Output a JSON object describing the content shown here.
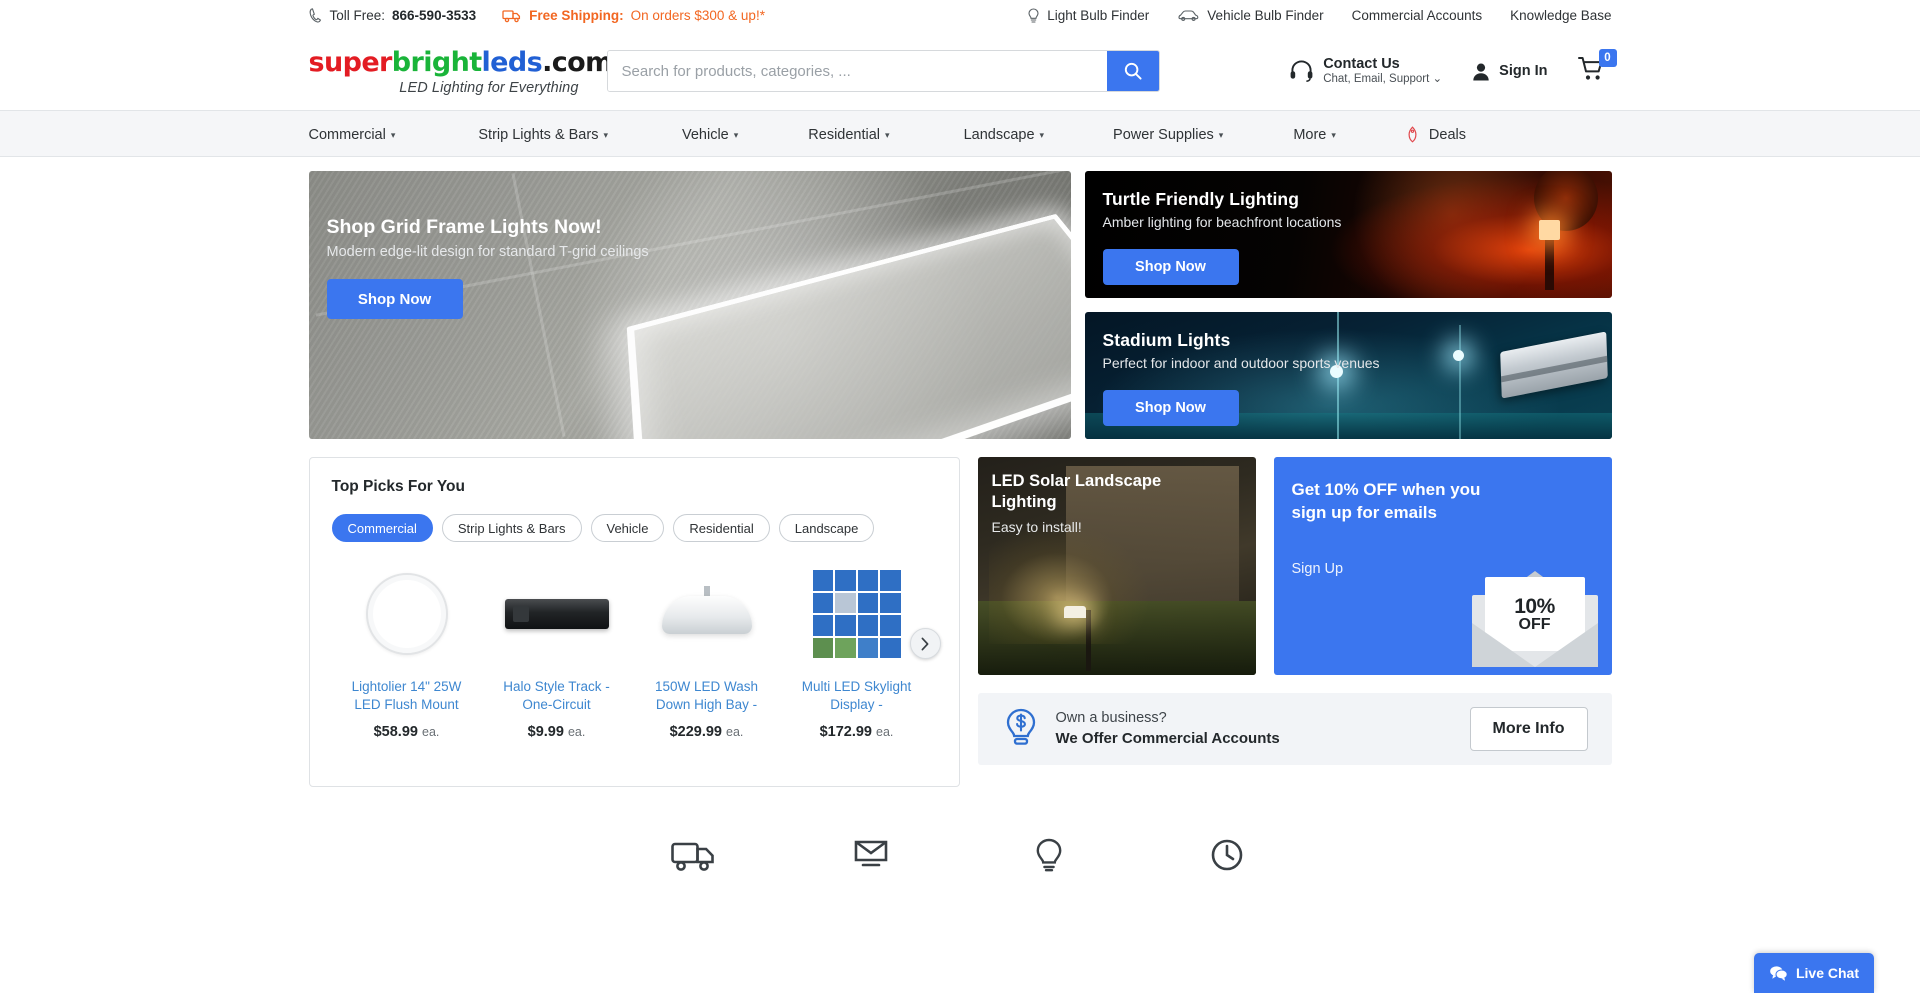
{
  "topbar": {
    "toll_free_label": "Toll Free:",
    "toll_free_number": "866-590-3533",
    "free_shipping_label": "Free Shipping:",
    "free_shipping_detail": "On orders $300 & up!*",
    "links": [
      {
        "label": "Light Bulb Finder",
        "icon": "lightbulb-icon"
      },
      {
        "label": "Vehicle Bulb Finder",
        "icon": "car-icon"
      },
      {
        "label": "Commercial Accounts",
        "icon": ""
      },
      {
        "label": "Knowledge Base",
        "icon": ""
      }
    ]
  },
  "header": {
    "logo": {
      "part1": "super",
      "part2": "bright",
      "part3": "leds",
      "part4": ".com",
      "reg": "®"
    },
    "tagline": "LED Lighting for Everything",
    "search": {
      "placeholder": "Search for products, categories, ...",
      "value": "",
      "button_icon": "search-icon"
    },
    "contact": {
      "title": "Contact Us",
      "subtitle": "Chat, Email, Support",
      "caret": "⌄"
    },
    "signin_label": "Sign In",
    "cart_count": "0"
  },
  "nav": {
    "items": [
      {
        "label": "Commercial",
        "caret": "▾"
      },
      {
        "label": "Strip Lights & Bars",
        "caret": "▾"
      },
      {
        "label": "Vehicle",
        "caret": "▾"
      },
      {
        "label": "Residential",
        "caret": "▾"
      },
      {
        "label": "Landscape",
        "caret": "▾"
      },
      {
        "label": "Power Supplies",
        "caret": "▾"
      },
      {
        "label": "More",
        "caret": "▾"
      }
    ],
    "deals_label": "Deals"
  },
  "hero": {
    "title": "Shop Grid Frame Lights Now!",
    "subtitle": "Modern edge-lit design for standard T-grid ceilings",
    "cta": "Shop Now"
  },
  "tiles": [
    {
      "title": "Turtle Friendly Lighting",
      "subtitle": "Amber lighting for beachfront locations",
      "cta": "Shop Now"
    },
    {
      "title": "Stadium Lights",
      "subtitle": "Perfect for indoor and outdoor sports venues",
      "cta": "Shop Now"
    }
  ],
  "top_picks": {
    "title": "Top Picks For You",
    "tabs": [
      {
        "label": "Commercial",
        "active": true
      },
      {
        "label": "Strip Lights & Bars",
        "active": false
      },
      {
        "label": "Vehicle",
        "active": false
      },
      {
        "label": "Residential",
        "active": false
      },
      {
        "label": "Landscape",
        "active": false
      }
    ],
    "products": [
      {
        "name": "Lightolier 14\" 25W LED Flush Mount",
        "price": "$58.99",
        "unit": "ea."
      },
      {
        "name": "Halo Style Track - One-Circuit",
        "price": "$9.99",
        "unit": "ea."
      },
      {
        "name": "150W LED Wash Down High Bay -",
        "price": "$229.99",
        "unit": "ea."
      },
      {
        "name": "Multi LED Skylight Display -",
        "price": "$172.99",
        "unit": "ea."
      }
    ],
    "next_icon": "chevron-right-icon"
  },
  "solar_card": {
    "title": "LED Solar Landscape Lighting",
    "subtitle": "Easy to install!"
  },
  "email_card": {
    "title": "Get 10% OFF when you sign up for emails",
    "link": "Sign Up",
    "badge_line1": "10%",
    "badge_line2": "OFF"
  },
  "business_bar": {
    "line1": "Own a business?",
    "line2": "We Offer Commercial Accounts",
    "button": "More Info",
    "icon": "lightbulb-dollar-icon"
  },
  "live_chat": {
    "label": "Live Chat",
    "icon": "chat-bubbles-icon"
  },
  "colors": {
    "accent_blue": "#3b76ef",
    "orange": "#f26722",
    "logo_red": "#e31c23",
    "logo_green": "#19b439",
    "logo_blue": "#2160d4",
    "link_blue": "#3e87d0"
  }
}
